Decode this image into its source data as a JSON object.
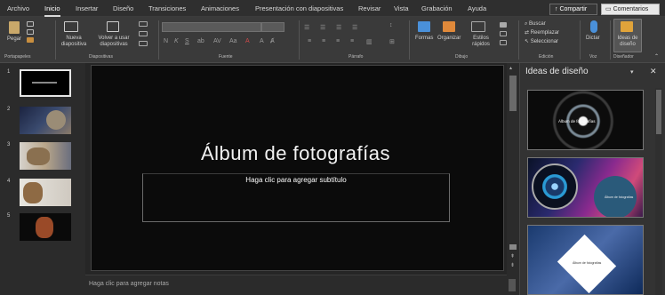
{
  "tabs": {
    "archivo": "Archivo",
    "inicio": "Inicio",
    "insertar": "Insertar",
    "diseno": "Diseño",
    "transiciones": "Transiciones",
    "animaciones": "Animaciones",
    "presentacion": "Presentación con diapositivas",
    "revisar": "Revisar",
    "vista": "Vista",
    "grabacion": "Grabación",
    "ayuda": "Ayuda"
  },
  "header": {
    "share": "Compartir",
    "comments": "Comentarios"
  },
  "ribbon": {
    "paste": "Pegar",
    "new_slide": "Nueva diapositiva",
    "reuse": "Volver a usar diapositivas",
    "shapes": "Formas",
    "arrange": "Organizar",
    "quick_styles": "Estilos rápidos",
    "find": "Buscar",
    "replace": "Reemplazar",
    "select": "Seleccionar",
    "dictate": "Dictar",
    "designer": "Ideas de diseño",
    "groups": {
      "clipboard": "Portapapeles",
      "slides": "Diapositivas",
      "font": "Fuente",
      "paragraph": "Párrafo",
      "drawing": "Dibujo",
      "editing": "Edición",
      "voice": "Voz",
      "designer": "Diseñador"
    },
    "font_name": "",
    "font_size": ""
  },
  "slides": [
    {
      "num": "1"
    },
    {
      "num": "2"
    },
    {
      "num": "3"
    },
    {
      "num": "4"
    },
    {
      "num": "5"
    }
  ],
  "slide": {
    "title": "Álbum de fotografías",
    "subtitle_placeholder": "Haga clic para agregar subtítulo"
  },
  "notes": {
    "placeholder": "Haga clic para agregar notas"
  },
  "design_pane": {
    "title": "Ideas de diseño",
    "cards": [
      {
        "caption": "Álbum de fotografías"
      },
      {
        "caption": "Álbum de fotografías"
      },
      {
        "caption": "Álbum de fotografías"
      }
    ]
  }
}
